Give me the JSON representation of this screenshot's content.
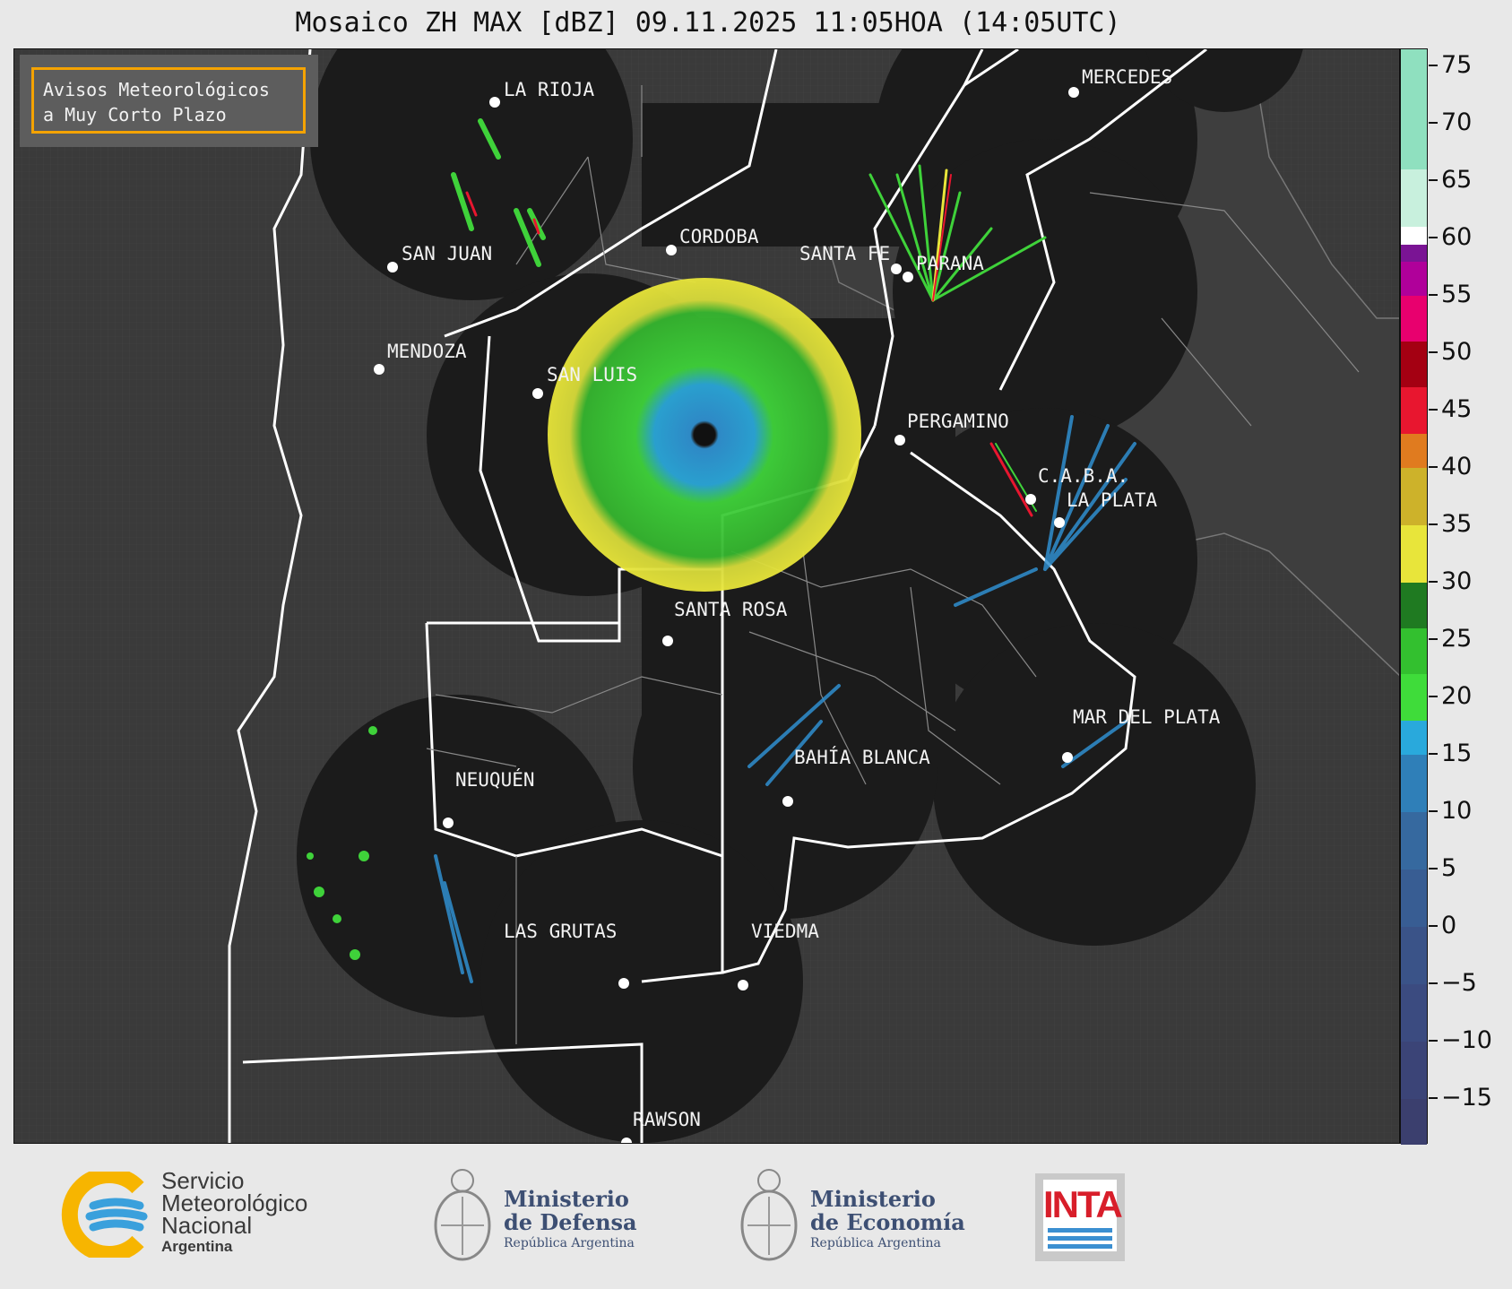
{
  "title": "Mosaico ZH MAX [dBZ] 09.11.2025 11:05HOA (14:05UTC)",
  "notice": {
    "line1": "Avisos Meteorológicos",
    "line2": "a Muy Corto Plazo",
    "border_color": "#f5a300"
  },
  "cities": [
    {
      "name": "LA RIOJA"
    },
    {
      "name": "MERCEDES"
    },
    {
      "name": "CORDOBA"
    },
    {
      "name": "SAN JUAN"
    },
    {
      "name": "SANTA FE"
    },
    {
      "name": "PARANA"
    },
    {
      "name": "MENDOZA"
    },
    {
      "name": "SAN LUIS"
    },
    {
      "name": "PERGAMINO"
    },
    {
      "name": "C.A.B.A."
    },
    {
      "name": "LA PLATA"
    },
    {
      "name": "SANTA ROSA"
    },
    {
      "name": "MAR DEL PLATA"
    },
    {
      "name": "BAHÍA BLANCA"
    },
    {
      "name": "NEUQUÉN"
    },
    {
      "name": "LAS GRUTAS"
    },
    {
      "name": "VIEDMA"
    },
    {
      "name": "RAWSON"
    }
  ],
  "colorbar": {
    "unit": "dBZ",
    "min": -19,
    "max": 76.5,
    "ticks": [
      75,
      70,
      65,
      60,
      55,
      50,
      45,
      40,
      35,
      30,
      25,
      20,
      15,
      10,
      5,
      0,
      -5,
      -10,
      -15
    ],
    "tick_labels": [
      "75",
      "70",
      "65",
      "60",
      "55",
      "50",
      "45",
      "40",
      "35",
      "30",
      "25",
      "20",
      "15",
      "10",
      "5",
      "0",
      "−5",
      "−10",
      "−15"
    ],
    "segments": [
      {
        "from": -19,
        "to": -15,
        "color": "#3b3f6e"
      },
      {
        "from": -15,
        "to": -10,
        "color": "#3b4477"
      },
      {
        "from": -10,
        "to": -5,
        "color": "#3b4b80"
      },
      {
        "from": -5,
        "to": 0,
        "color": "#3a5388"
      },
      {
        "from": 0,
        "to": 5,
        "color": "#385d93"
      },
      {
        "from": 5,
        "to": 10,
        "color": "#36699f"
      },
      {
        "from": 10,
        "to": 15,
        "color": "#2f7fb8"
      },
      {
        "from": 15,
        "to": 18,
        "color": "#29a9dc"
      },
      {
        "from": 18,
        "to": 22,
        "color": "#3fdc3a"
      },
      {
        "from": 22,
        "to": 26,
        "color": "#33c02f"
      },
      {
        "from": 26,
        "to": 30,
        "color": "#1f7a21"
      },
      {
        "from": 30,
        "to": 35,
        "color": "#e8e53a"
      },
      {
        "from": 35,
        "to": 40,
        "color": "#cdb22a"
      },
      {
        "from": 40,
        "to": 43,
        "color": "#e07b1f"
      },
      {
        "from": 43,
        "to": 47,
        "color": "#e8162f"
      },
      {
        "from": 47,
        "to": 51,
        "color": "#a40012"
      },
      {
        "from": 51,
        "to": 55,
        "color": "#e8006e"
      },
      {
        "from": 55,
        "to": 58,
        "color": "#b0009a"
      },
      {
        "from": 58,
        "to": 59.5,
        "color": "#7a1494"
      },
      {
        "from": 59.5,
        "to": 61,
        "color": "#ffffff"
      },
      {
        "from": 61,
        "to": 66,
        "color": "#c8f0dd"
      },
      {
        "from": 66,
        "to": 76.5,
        "color": "#8fe0bf"
      }
    ]
  },
  "logos": {
    "smn": {
      "line1": "Servicio",
      "line2": "Meteorológico",
      "line3": "Nacional",
      "line4": "Argentina"
    },
    "defensa": {
      "line1": "Ministerio",
      "line2": "de Defensa",
      "line3": "República Argentina"
    },
    "economia": {
      "line1": "Ministerio",
      "line2": "de Economía",
      "line3": "República Argentina"
    },
    "inta": {
      "word": "INTA"
    }
  },
  "colors": {
    "background": "#e8e8e8",
    "map_background": "#3a3a3a",
    "radar_coverage": "#1b1b1b",
    "borders": "#ffffff"
  }
}
